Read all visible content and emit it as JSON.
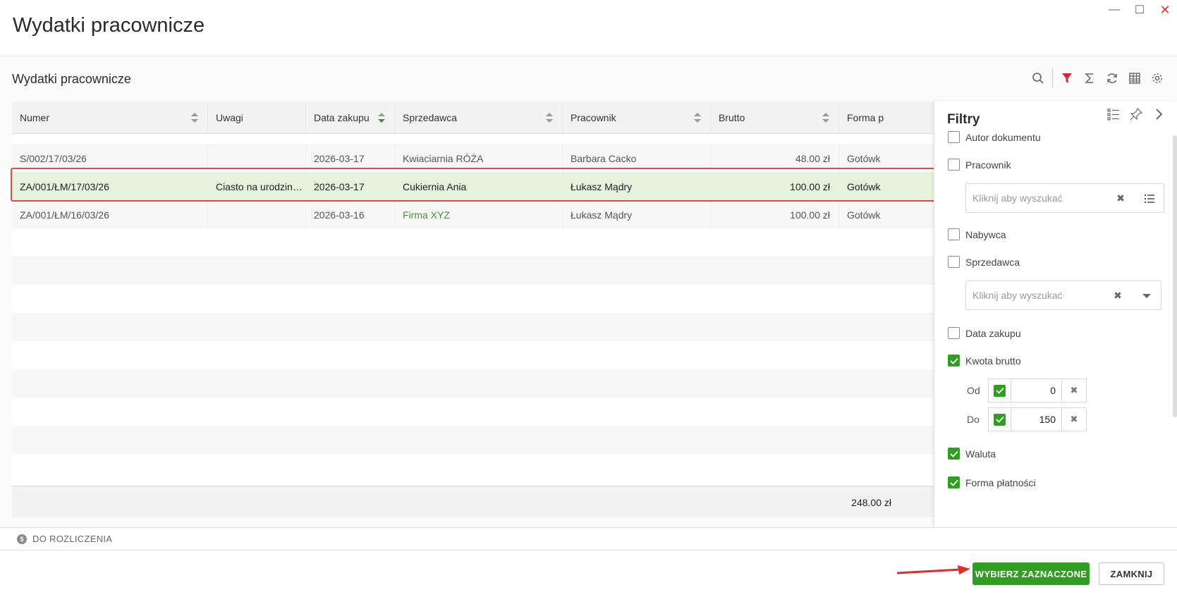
{
  "window": {
    "title": "Wydatki pracownicze"
  },
  "list": {
    "title": "Wydatki pracownicze"
  },
  "columns": [
    {
      "label": "Numer"
    },
    {
      "label": "Uwagi"
    },
    {
      "label": "Data zakupu"
    },
    {
      "label": "Sprzedawca"
    },
    {
      "label": "Pracownik"
    },
    {
      "label": "Brutto"
    },
    {
      "label": "Forma p"
    }
  ],
  "rows": [
    {
      "numer": "S/002/17/03/26",
      "uwagi": "",
      "data": "2026-03-17",
      "sprzedawca": "Kwiaciarnia RÓŻA",
      "pracownik": "Barbara Cacko",
      "brutto": "48.00 zł",
      "forma": "Gotówk"
    },
    {
      "numer": "ZA/001/ŁM/17/03/26",
      "uwagi": "Ciasto na urodzin…",
      "data": "2026-03-17",
      "sprzedawca": "Cukiernia Ania",
      "pracownik": "Łukasz Mądry",
      "brutto": "100.00 zł",
      "forma": "Gotówk"
    },
    {
      "numer": "ZA/001/ŁM/16/03/26",
      "uwagi": "",
      "data": "2026-03-16",
      "sprzedawca": "Firma XYZ",
      "pracownik": "Łukasz Mądry",
      "brutto": "100.00 zł",
      "forma": "Gotówk"
    }
  ],
  "summary": {
    "brutto_total": "248.00 zł"
  },
  "filters": {
    "title": "Filtry",
    "autor": "Autor dokumentu",
    "pracownik": "Pracownik",
    "pracownik_placeholder": "Kliknij aby wyszukać",
    "nabywca": "Nabywca",
    "sprzedawca": "Sprzedawca",
    "sprzedawca_placeholder": "Kliknij aby wyszukać",
    "data_zakupu": "Data zakupu",
    "kwota_brutto": "Kwota brutto",
    "od_label": "Od",
    "od_value": "0",
    "do_label": "Do",
    "do_value": "150",
    "waluta": "Waluta",
    "forma_platnosci": "Forma płatności"
  },
  "status": {
    "label": "DO ROZLICZENIA",
    "icon_glyph": "$"
  },
  "buttons": {
    "select": "WYBIERZ ZAZNACZONE",
    "close": "ZAMKNIJ"
  },
  "window_controls": {
    "minimize": "—",
    "maximize": "☐",
    "close": "✕"
  },
  "colors": {
    "accent": "#2f9e21",
    "selected_row": "#e5f2dc",
    "highlight": "#e34848",
    "filter_active": "#d0283c"
  }
}
